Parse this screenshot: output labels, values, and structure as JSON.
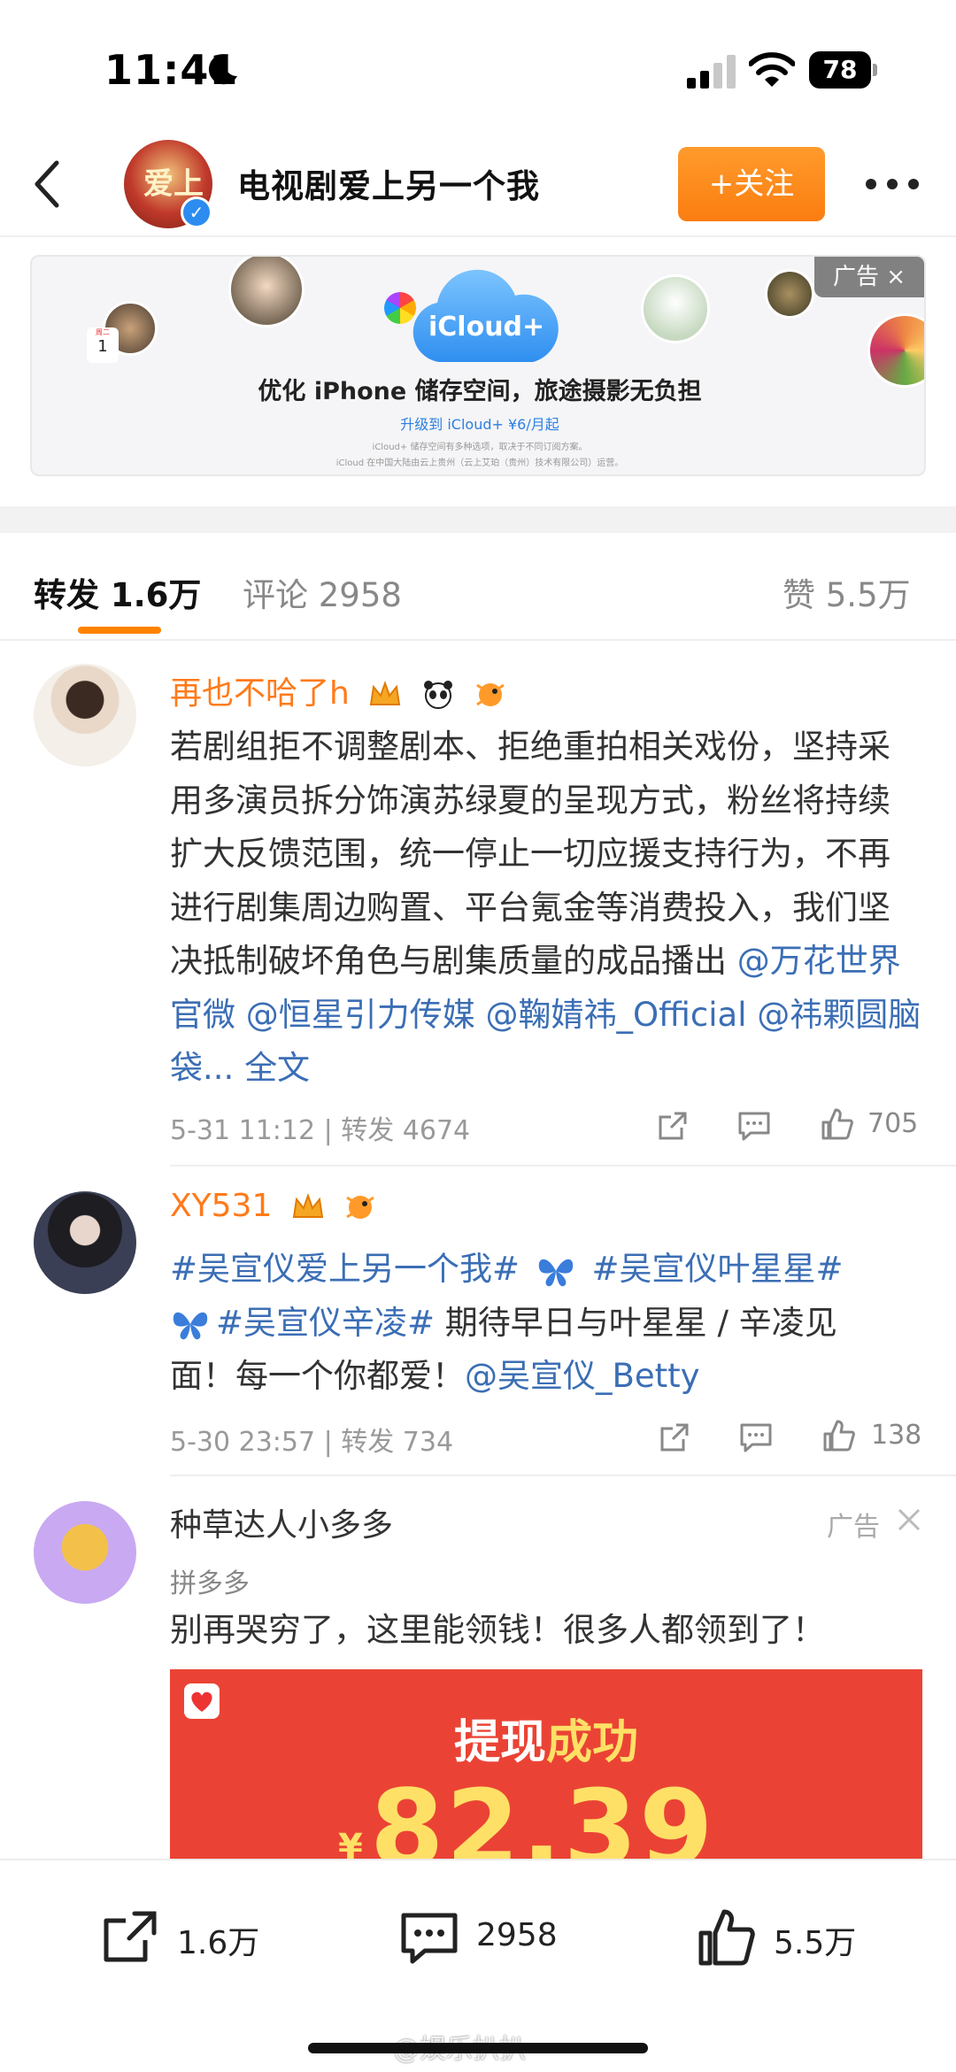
{
  "status_bar": {
    "time": "11:41",
    "battery": "78"
  },
  "header": {
    "title": "电视剧爱上另一个我",
    "avatar_text": "爱上",
    "follow_label": "+关注"
  },
  "ad_banner": {
    "tag": "广告 ×",
    "badge_day": "周二",
    "badge_num": "1",
    "brand": "iCloud+",
    "headline": "优化 iPhone 储存空间，旅途摄影无负担",
    "subline": "升级到 iCloud+ ¥6/月起",
    "fine_print_1": "iCloud+ 储存空间有多种选项，取决于不同订阅方案。",
    "fine_print_2": "iCloud 在中国大陆由云上贵州（云上艾珀（贵州）技术有限公司）运营。"
  },
  "tabs": {
    "repost": "转发 1.6万",
    "comment": "评论 2958",
    "like": "赞 5.5万"
  },
  "posts": [
    {
      "username": "再也不哈了h",
      "text": "若剧组拒不调整剧本、拒绝重拍相关戏份，坚持采用多演员拆分饰演苏绿夏的呈现方式，粉丝将持续扩大反馈范围，统一停止一切应援支持行为，不再进行剧集周边购置、平台氪金等消费投入，我们坚决抵制破坏角色与剧集质量的成品播出",
      "mentions": "@万花世界官微 @恒星引力传媒 @鞠婧祎_Official @祎颗圆脑袋...",
      "full_text": "全文",
      "meta": "5-31 11:12 | 转发 4674",
      "likes": "705"
    },
    {
      "username": "XY531",
      "text_line1_tag1": "#吴宣仪爱上另一个我#",
      "text_line1_tag2": "#吴宣仪叶星星#",
      "text_line2_tag": "#吴宣仪辛凌#",
      "text_line2_rest": " 期待早日与叶星星 / 辛凌见",
      "text_line3_plain": "面！每一个你都爱！",
      "text_line3_mention": "@吴宣仪_Betty",
      "meta": "5-30 23:57 | 转发 734",
      "likes": "138"
    }
  ],
  "ad_post": {
    "name": "种草达人小多多",
    "tag": "广告",
    "source": "拼多多",
    "text": "别再哭穷了，这里能领钱！很多人都领到了！",
    "promo_title_a": "提现",
    "promo_title_b": "成功",
    "promo_yen": "¥",
    "promo_amount": "82.39"
  },
  "bottom_bar": {
    "repost_count": "1.6万",
    "comment_count": "2958",
    "like_count": "5.5万"
  },
  "watermark": "@娱乐扒扒"
}
